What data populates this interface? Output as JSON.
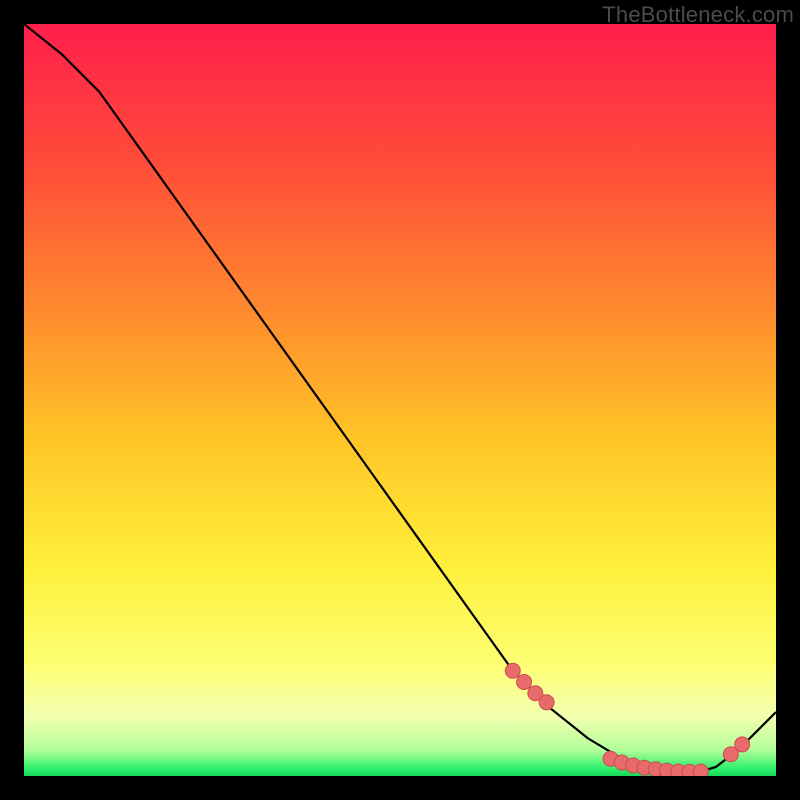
{
  "watermark": "TheBottleneck.com",
  "colors": {
    "line": "#000000",
    "marker_fill": "#e86a6a",
    "marker_stroke": "#c94f4f"
  },
  "chart_data": {
    "type": "line",
    "title": "",
    "xlabel": "",
    "ylabel": "",
    "xlim": [
      0,
      100
    ],
    "ylim": [
      0,
      100
    ],
    "curve": {
      "x": [
        0,
        5,
        10,
        15,
        20,
        25,
        30,
        35,
        40,
        45,
        50,
        55,
        60,
        65,
        70,
        75,
        80,
        82,
        85,
        88,
        90,
        92,
        95,
        100
      ],
      "y": [
        100,
        96,
        91,
        84,
        77,
        70,
        63,
        56,
        49,
        42,
        35,
        28,
        21,
        14,
        9,
        5,
        2,
        1,
        0.6,
        0.5,
        0.6,
        1.2,
        3.5,
        8.5
      ]
    },
    "markers": {
      "x": [
        65,
        66.5,
        68,
        69.5,
        78,
        79.5,
        81,
        82.5,
        84,
        85.5,
        87,
        88.5,
        90,
        94,
        95.5
      ],
      "y": [
        14,
        12.5,
        11,
        9.8,
        2.3,
        1.8,
        1.4,
        1.1,
        0.9,
        0.7,
        0.6,
        0.55,
        0.6,
        2.9,
        4.2
      ]
    }
  }
}
